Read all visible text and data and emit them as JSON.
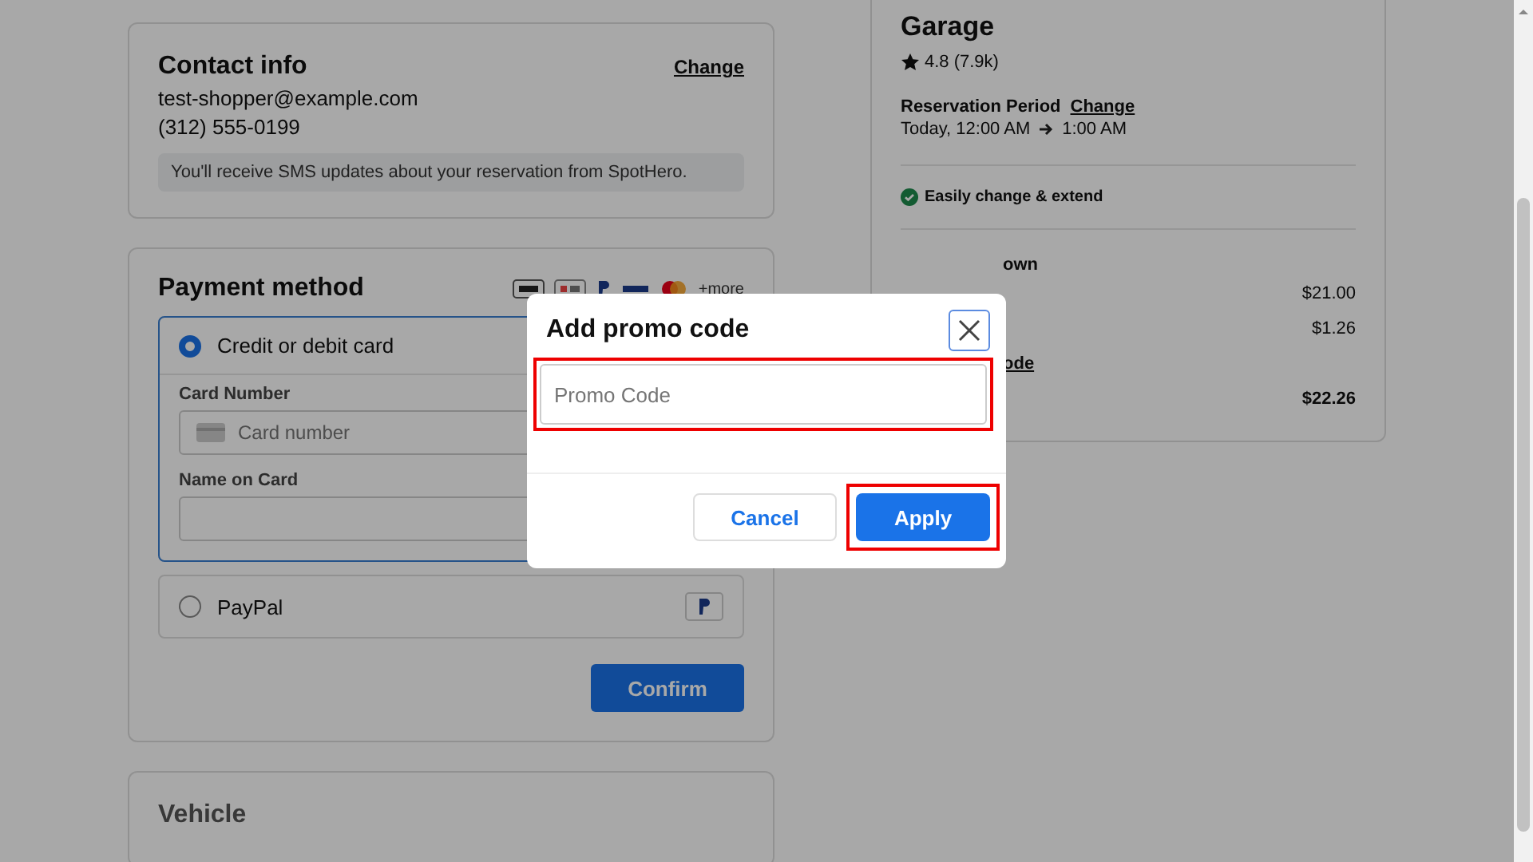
{
  "contact": {
    "title": "Contact info",
    "change": "Change",
    "email": "test-shopper@example.com",
    "phone": "(312) 555-0199",
    "note": "You'll receive SMS updates about your reservation from SpotHero."
  },
  "payment": {
    "title": "Payment method",
    "more": "+more",
    "methods": [
      {
        "kind": "card",
        "label": "Credit or debit card",
        "selected": true,
        "fields": [
          {
            "label": "Card Number",
            "placeholder": "Card number",
            "card_icon": true
          },
          {
            "label": "Name on Card",
            "card_icon": false
          }
        ]
      },
      {
        "kind": "paypal",
        "label": "PayPal",
        "selected": false
      }
    ],
    "confirm": "Confirm"
  },
  "vehicle": {
    "title": "Vehicle"
  },
  "summary": {
    "title": "Garage",
    "rating": "4.8 (7.9k)",
    "period_label": "Reservation Period",
    "change": "Change",
    "start": "Today, 12:00 AM",
    "end": "1:00 AM",
    "feature": "Easily change & extend",
    "breakdown_title": "own",
    "lines": [
      {
        "kind": "amount",
        "value": "$21.00"
      },
      {
        "kind": "amount",
        "value": "$1.26"
      },
      {
        "kind": "link",
        "label": "ode"
      },
      {
        "kind": "total",
        "value": "$22.26"
      }
    ]
  },
  "modal": {
    "title": "Add promo code",
    "placeholder": "Promo Code",
    "field_highlighted": true,
    "cancel": "Cancel",
    "apply": "Apply",
    "apply_highlighted": true
  }
}
